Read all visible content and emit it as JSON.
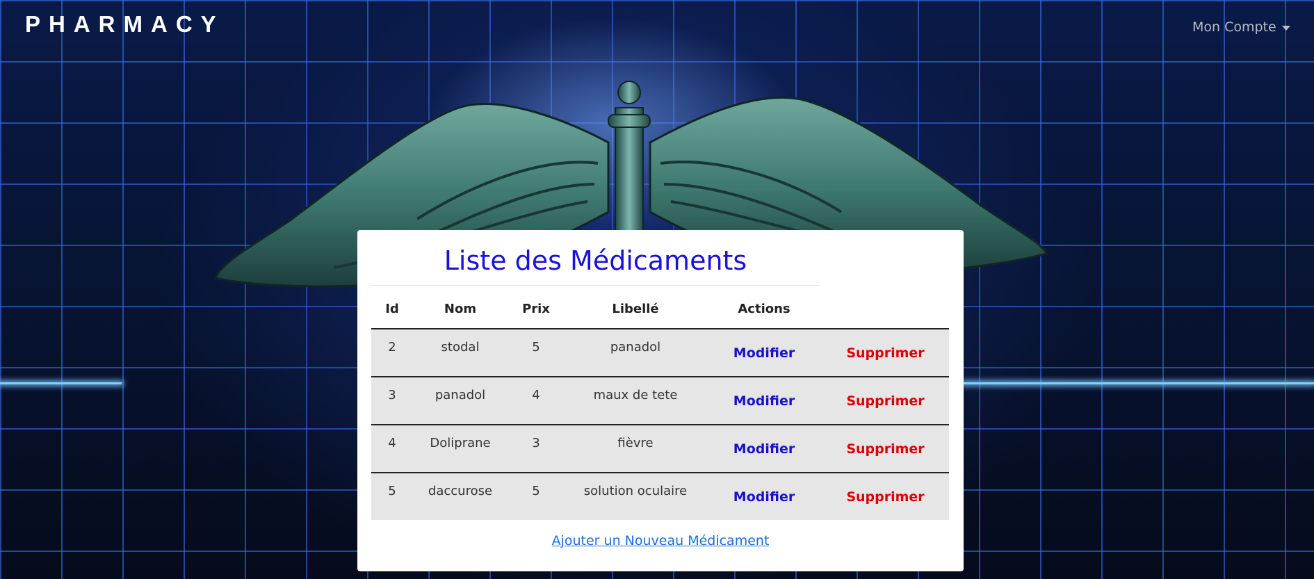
{
  "nav": {
    "brand": "PHARMACY",
    "account_label": "Mon Compte"
  },
  "main": {
    "title": "Liste des Médicaments",
    "add_link": "Ajouter un Nouveau Médicament"
  },
  "table": {
    "headers": {
      "id": "Id",
      "nom": "Nom",
      "prix": "Prix",
      "libelle": "Libellé",
      "actions": "Actions"
    },
    "rows": [
      {
        "id": "2",
        "nom": "stodal",
        "prix": "5",
        "libelle": "panadol",
        "edit": "Modifier",
        "delete": "Supprimer"
      },
      {
        "id": "3",
        "nom": "panadol",
        "prix": "4",
        "libelle": "maux de tete",
        "edit": "Modifier",
        "delete": "Supprimer"
      },
      {
        "id": "4",
        "nom": "Doliprane",
        "prix": "3",
        "libelle": "fièvre",
        "edit": "Modifier",
        "delete": "Supprimer"
      },
      {
        "id": "5",
        "nom": "daccurose",
        "prix": "5",
        "libelle": "solution oculaire",
        "edit": "Modifier",
        "delete": "Supprimer"
      }
    ]
  },
  "colors": {
    "title": "#1a12d8",
    "edit": "#1a12c8",
    "delete": "#e00000",
    "link": "#1a6ce0"
  },
  "icons": {
    "account_caret": "caret-down-icon",
    "background_art": "caduceus-wings-icon"
  }
}
